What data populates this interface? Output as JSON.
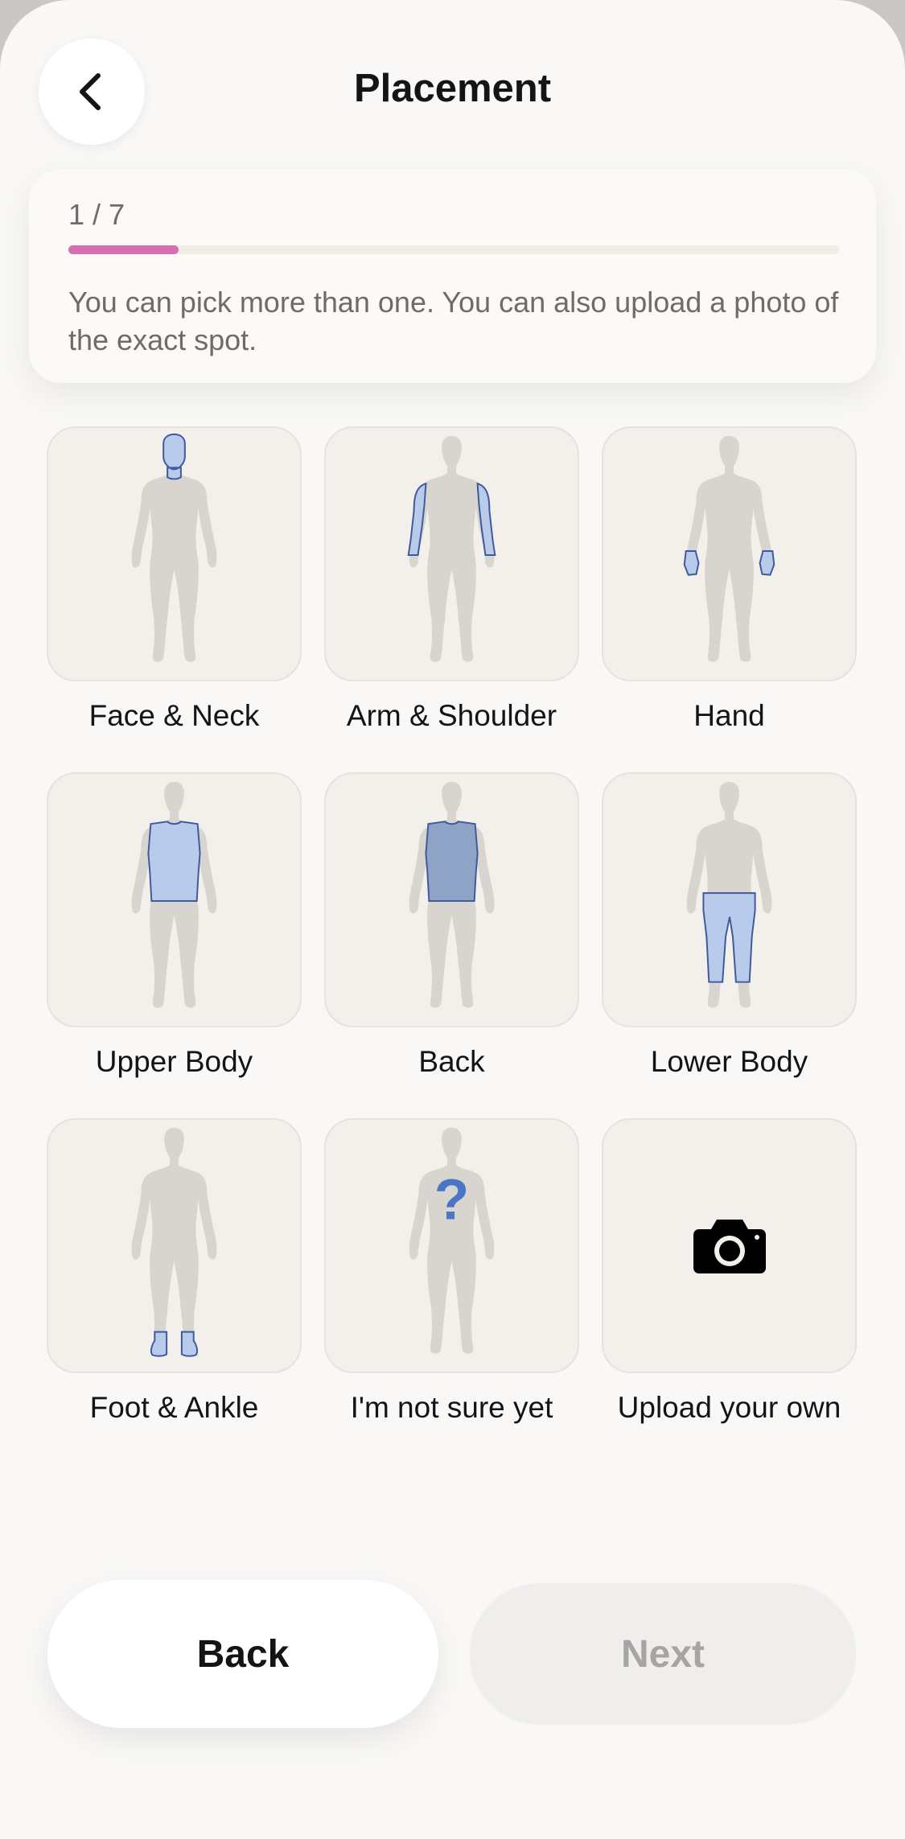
{
  "header": {
    "title": "Placement",
    "back_icon": "chevron-left-icon"
  },
  "progress": {
    "step_label": "1 / 7",
    "current_step": 1,
    "total_steps": 7,
    "fraction": 0.143,
    "bar_color": "#d66fb0",
    "hint": "You can pick more than one. You can also upload a photo of the exact spot."
  },
  "options": [
    {
      "label": "Face & Neck",
      "icon": "face-neck-body-icon"
    },
    {
      "label": "Arm & Shoulder",
      "icon": "arm-shoulder-body-icon"
    },
    {
      "label": "Hand",
      "icon": "hand-body-icon"
    },
    {
      "label": "Upper Body",
      "icon": "upper-body-icon"
    },
    {
      "label": "Back",
      "icon": "back-body-icon"
    },
    {
      "label": "Lower Body",
      "icon": "lower-body-icon"
    },
    {
      "label": "Foot & Ankle",
      "icon": "foot-ankle-body-icon"
    },
    {
      "label": "I'm not sure yet",
      "icon": "question-mark-body-icon"
    },
    {
      "label": "Upload your own",
      "icon": "camera-icon"
    }
  ],
  "colors": {
    "highlight": "#b8cbea",
    "highlight_stroke": "#3e5a9c",
    "back_region": "#8ea3c6",
    "question_mark": "#4a75c4",
    "silhouette": "#d8d4d0"
  },
  "footer": {
    "back_label": "Back",
    "next_label": "Next",
    "next_enabled": false
  }
}
